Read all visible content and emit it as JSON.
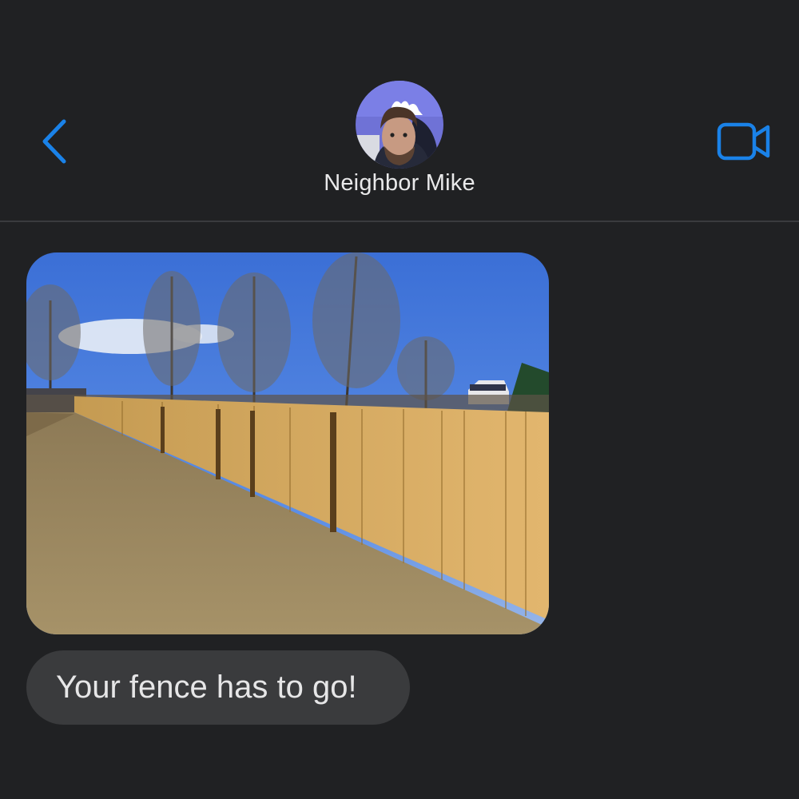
{
  "header": {
    "contact_name": "Neighbor Mike",
    "back_icon": "chevron-left-icon",
    "video_icon": "video-camera-icon",
    "accent_color": "#1a82e8"
  },
  "messages": [
    {
      "type": "image",
      "from": "contact"
    },
    {
      "type": "text",
      "from": "contact",
      "text": "Your fence has to go!"
    }
  ]
}
